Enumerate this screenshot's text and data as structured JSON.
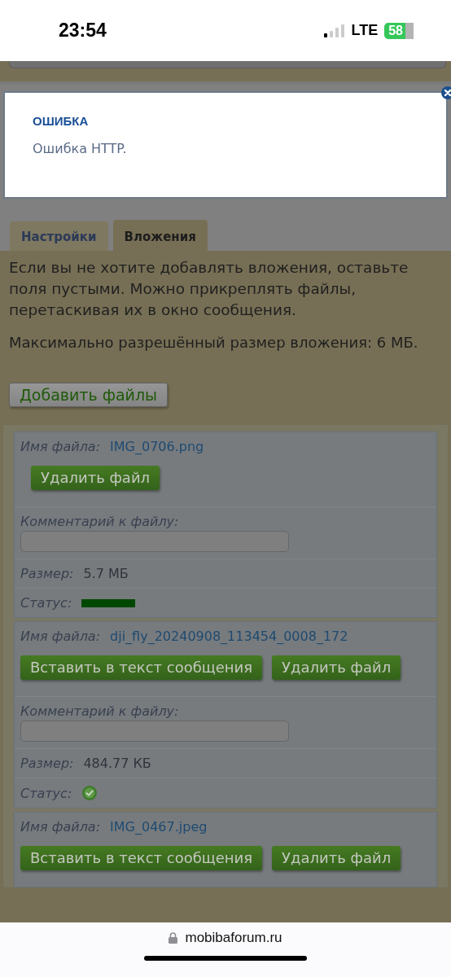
{
  "status_bar": {
    "time": "23:54",
    "network": "LTE",
    "battery": "58"
  },
  "dialog": {
    "title": "ОШИБКА",
    "message": "Ошибка HTTP."
  },
  "tabs": [
    {
      "label": "Настройки",
      "selected": false
    },
    {
      "label": "Вложения",
      "selected": true
    }
  ],
  "intro": "Если вы не хотите добавлять вложения, оставьте поля пустыми. Можно прикреплять файлы, перетаскивая их в окно сообщения.",
  "max_size": "Максимально разрешённый размер вложения: 6 МБ.",
  "add_button": "Добавить файлы",
  "files": [
    {
      "name_label": "Имя файла:",
      "name": "IMG_0706.png",
      "buttons": [
        "Удалить файл"
      ],
      "comment_label": "Комментарий к файлу:",
      "size_label": "Размер:",
      "size": "5.7 МБ",
      "status_label": "Статус:",
      "status": {
        "kind": "progress"
      }
    },
    {
      "name_label": "Имя файла:",
      "name": "dji_fly_20240908_113454_0008_172",
      "buttons": [
        "Вставить в текст сообщения",
        "Удалить файл"
      ],
      "comment_label": "Комментарий к файлу:",
      "size_label": "Размер:",
      "size": "484.77 КБ",
      "status_label": "Статус:",
      "status": {
        "kind": "done"
      }
    },
    {
      "name_label": "Имя файла:",
      "name": "IMG_0467.jpeg",
      "buttons": [
        "Вставить в текст сообщения",
        "Удалить файл"
      ]
    }
  ],
  "address_bar": {
    "url": "mobibaforum.ru"
  }
}
